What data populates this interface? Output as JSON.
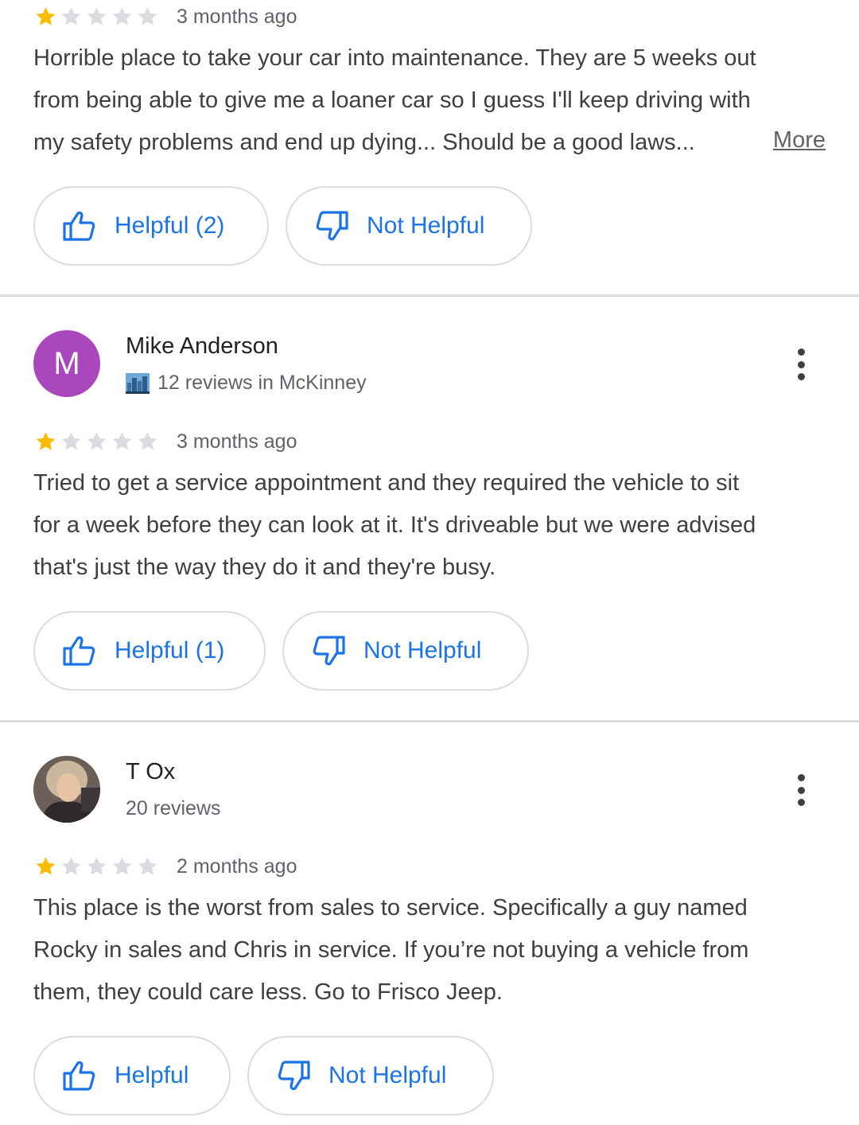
{
  "colors": {
    "star_filled": "#fbbc04",
    "star_empty": "#dadce0",
    "link_blue": "#1a73e8",
    "avatar_purple": "#ab47bc"
  },
  "reviews": [
    {
      "rating": 1,
      "time": "3 months ago",
      "lines": [
        "Horrible place to take your car into maintenance. They are 5 weeks out",
        "from being able to give me a loaner car so I guess I'll keep driving with",
        "my safety problems and end up dying... Should be a good laws..."
      ],
      "more_label": "More",
      "helpful_label": "Helpful (2)",
      "not_helpful_label": "Not Helpful"
    },
    {
      "author": "Mike Anderson",
      "avatar_letter": "M",
      "meta": "12 reviews in McKinney",
      "meta_icon": "city-skyline-icon",
      "rating": 1,
      "time": "3 months ago",
      "lines": [
        "Tried to get a service appointment and they required the vehicle to sit",
        "for a week before they can look at it. It's driveable but we were advised",
        "that's just the way they do it and they're busy."
      ],
      "helpful_label": "Helpful (1)",
      "not_helpful_label": "Not Helpful"
    },
    {
      "author": "T Ox",
      "avatar_icon": "profile-photo",
      "meta": "20 reviews",
      "rating": 1,
      "time": "2 months ago",
      "lines": [
        "This place is the worst from sales to service.  Specifically a guy named",
        "Rocky in sales and Chris in service.  If you’re not buying a vehicle from",
        "them, they could care less.  Go to Frisco Jeep."
      ],
      "helpful_label": "Helpful",
      "not_helpful_label": "Not Helpful"
    }
  ]
}
